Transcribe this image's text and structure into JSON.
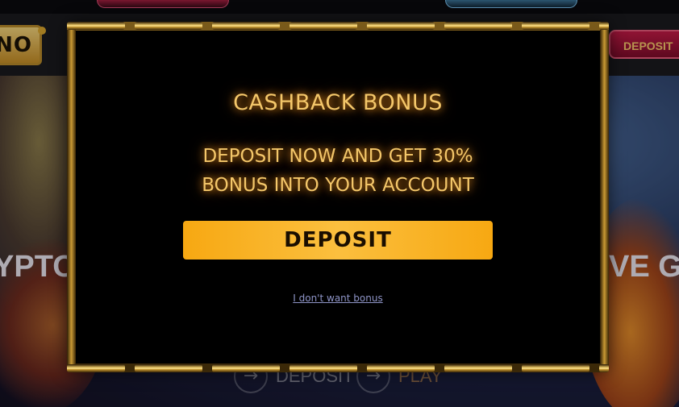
{
  "topbar": {
    "buttons": [
      {
        "id": "red-tab",
        "color": "#7a1730"
      },
      {
        "id": "blue-tab",
        "color": "#2c5570"
      }
    ]
  },
  "header": {
    "logo_text": "NO",
    "deposit_label": "DEPOSIT"
  },
  "hero": {
    "text_left": "YPTO",
    "text_right": "VE G",
    "actions": [
      {
        "label": "DEPOSIT",
        "icon": "arrow-right-icon"
      },
      {
        "label": "PLAY",
        "icon": "arrow-right-icon"
      }
    ]
  },
  "modal": {
    "title": "CASHBACK BONUS",
    "text_line1": "DEPOSIT NOW AND GET 30%",
    "text_line2": "BONUS INTO YOUR ACCOUNT",
    "deposit_button": "DEPOSIT",
    "decline_link": "I don't want bonus"
  },
  "colors": {
    "accent_gold": "#f4c76a",
    "button_orange": "#fbbf3e",
    "header_deposit": "#c01a45",
    "link": "#8f95c8"
  }
}
